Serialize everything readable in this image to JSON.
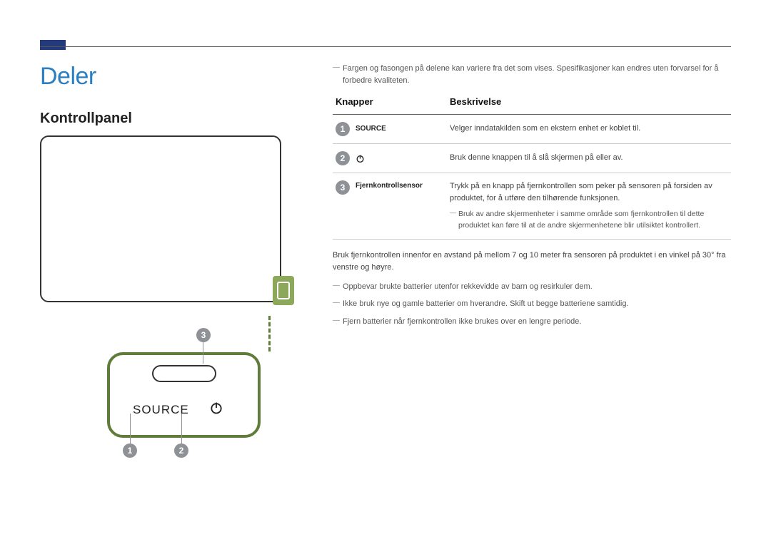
{
  "headings": {
    "title": "Deler",
    "section": "Kontrollpanel"
  },
  "intro_note": "Fargen og fasongen på delene kan variere fra det som vises. Spesifikasjoner kan endres uten forvarsel for å forbedre kvaliteten.",
  "table": {
    "headers": {
      "col1": "Knapper",
      "col2": "Beskrivelse"
    },
    "rows": [
      {
        "num": "1",
        "label": "SOURCE",
        "desc": "Velger inndatakilden som en ekstern enhet er koblet til."
      },
      {
        "num": "2",
        "label": "",
        "desc": "Bruk denne knappen til å slå skjermen på eller av."
      },
      {
        "num": "3",
        "label": "Fjernkontrollsensor",
        "desc": "Trykk på en knapp på fjernkontrollen som peker på sensoren på forsiden av produktet, for å utføre den tilhørende funksjonen.",
        "sub_note": "Bruk av andre skjermenheter i samme område som fjernkontrollen til dette produktet kan føre til at de andre skjermenhetene blir utilsiktet kontrollert."
      }
    ]
  },
  "body_text": "Bruk fjernkontrollen innenfor en avstand på mellom 7 og 10 meter fra sensoren på produktet i en vinkel på 30° fra venstre og høyre.",
  "bottom_notes": [
    "Oppbevar brukte batterier utenfor rekkevidde av barn og resirkuler dem.",
    "Ikke bruk nye og gamle batterier om hverandre. Skift ut begge batteriene samtidig.",
    "Fjern batterier når fjernkontrollen ikke brukes over en lengre periode."
  ],
  "diagram": {
    "source_label": "SOURCE",
    "badges": {
      "b1": "1",
      "b2": "2",
      "b3": "3"
    }
  }
}
